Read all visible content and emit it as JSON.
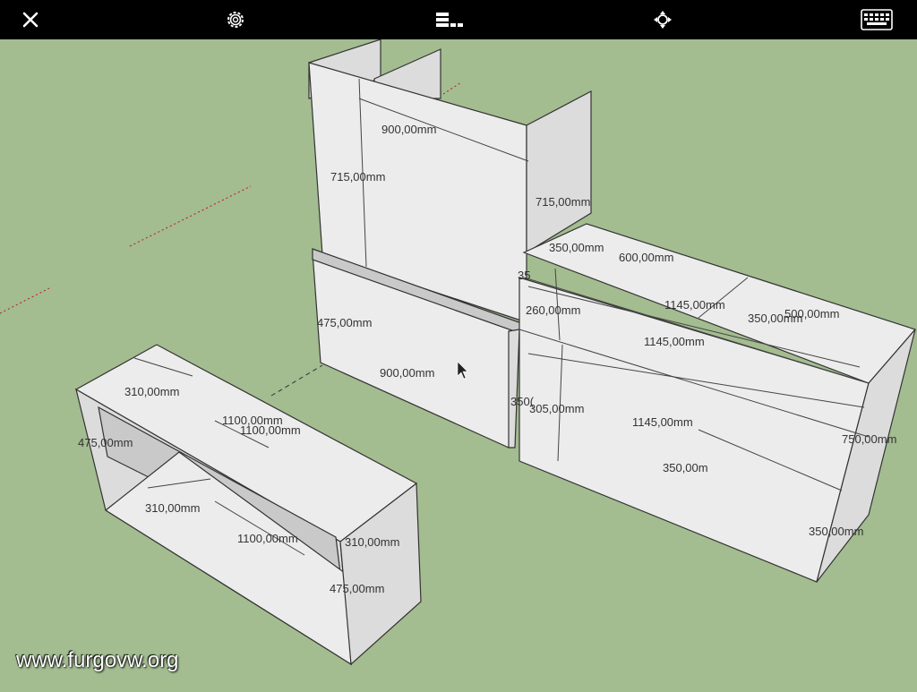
{
  "toolbar": {
    "buttons": [
      {
        "name": "close-button",
        "icon": "close-icon"
      },
      {
        "name": "settings-button",
        "icon": "gear-icon"
      },
      {
        "name": "layers-button",
        "icon": "layers-icon"
      },
      {
        "name": "orbit-button",
        "icon": "orbit-icon"
      },
      {
        "name": "keyboard-button",
        "icon": "keyboard-icon"
      }
    ]
  },
  "dimensions": {
    "top_width": "900,00mm",
    "top_height_left": "715,00mm",
    "top_height_right": "715,00mm",
    "small_350": "350,00mm",
    "shelf_600": "600,00mm",
    "shelf_35": "35",
    "shelf_260": "260,00mm",
    "shelf_1145_a": "1145,00mm",
    "shelf_350_b": "350,00mm",
    "shelf_500": "500,00mm",
    "shelf_1145_b": "1145,00mm",
    "mid_475": "475,00mm",
    "mid_900": "900,00mm",
    "mid_small": "350(",
    "mid_305": "305,00mm",
    "long_1145": "1145,00mm",
    "right_750": "750,00mm",
    "bottom_350": "350,00m",
    "right_350": "350,00mm",
    "box_310_top": "310,00mm",
    "box_1100_a": "1100,00mm",
    "box_1100_b": "1100,00mm",
    "box_475_left": "475,00mm",
    "box_310_inner": "310,00mm",
    "box_1100_inner": "1100,00mm",
    "box_310_right": "310,00mm",
    "box_475_right": "475,00mm"
  },
  "watermark": "www.furgovw.org"
}
